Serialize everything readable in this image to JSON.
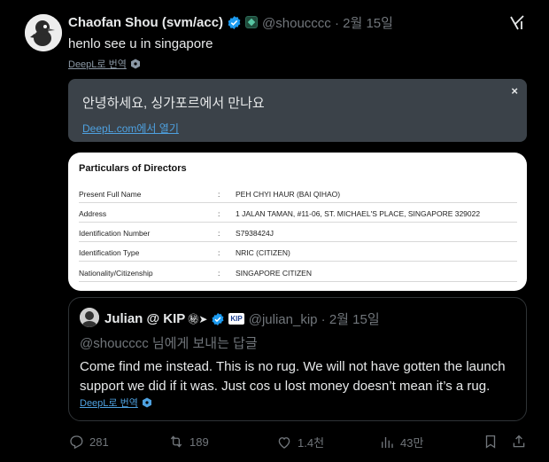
{
  "tweet": {
    "author_name": "Chaofan Shou (svm/acc)",
    "handle": "@shoucccc",
    "date": "2월 15일",
    "text": "henlo see u in singapore",
    "translate_label": "DeepL로 번역"
  },
  "translation": {
    "text": "안녕하세요, 싱가포르에서 만나요",
    "open_label": "DeepL.com에서 열기",
    "close_label": "×"
  },
  "document": {
    "title": "Particulars of Directors",
    "separator": ":",
    "rows": [
      {
        "label": "Present Full Name",
        "value": "PEH CHYI HAUR (BAI QIHAO)"
      },
      {
        "label": "Address",
        "value": "1 JALAN TAMAN, #11-06, ST. MICHAEL'S PLACE, SINGAPORE 329022"
      },
      {
        "label": "Identification Number",
        "value": "S7938424J"
      },
      {
        "label": "Identification Type",
        "value": "NRIC (CITIZEN)"
      },
      {
        "label": "Nationality/Citizenship",
        "value": "SINGAPORE CITIZEN"
      }
    ]
  },
  "quote": {
    "author_name": "Julian @ KIP",
    "emoji": "㊙➤",
    "kip_badge": "KIP",
    "handle": "@julian_kip",
    "date": "2월 15일",
    "reply_to": "@shoucccc 님에게 보내는 답글",
    "text": "Come find me instead. This is no rug. We will not have gotten the launch support we did if it was. Just cos u lost money doesn’t mean it’s a rug.",
    "translate_label": "DeepL로 번역"
  },
  "actions": {
    "replies": "281",
    "retweets": "189",
    "likes": "1.4천",
    "views": "43만"
  },
  "colors": {
    "background": "#000000",
    "accent": "#1d9bf0",
    "muted": "#71767b",
    "translation_box": "#3b4249"
  }
}
